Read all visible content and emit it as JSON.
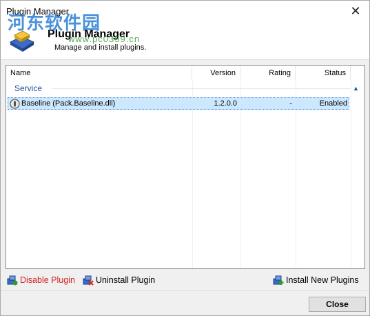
{
  "window": {
    "title": "Plugin Manager",
    "close_glyph": "✕"
  },
  "header": {
    "title": "Plugin Manager",
    "subtitle": "Manage and install plugins.",
    "icon": "plugin-icon"
  },
  "watermark": {
    "text": "河东软件园",
    "url": "www.pc0359.cn"
  },
  "list": {
    "columns": {
      "name": "Name",
      "version": "Version",
      "rating": "Rating",
      "status": "Status"
    },
    "group": {
      "label": "Service",
      "collapse_glyph": "▲"
    },
    "rows": [
      {
        "name": "Baseline (Pack.Baseline.dll)",
        "version": "1.2.0.0",
        "rating": "-",
        "status": "Enabled",
        "selected": true
      }
    ]
  },
  "actions": {
    "disable": "Disable Plugin",
    "uninstall": "Uninstall Plugin",
    "install": "Install New Plugins"
  },
  "footer": {
    "close_label": "Close"
  },
  "colors": {
    "disable_text": "#d42020",
    "group_text": "#1e4fa0",
    "selection": "#cce8ff"
  }
}
